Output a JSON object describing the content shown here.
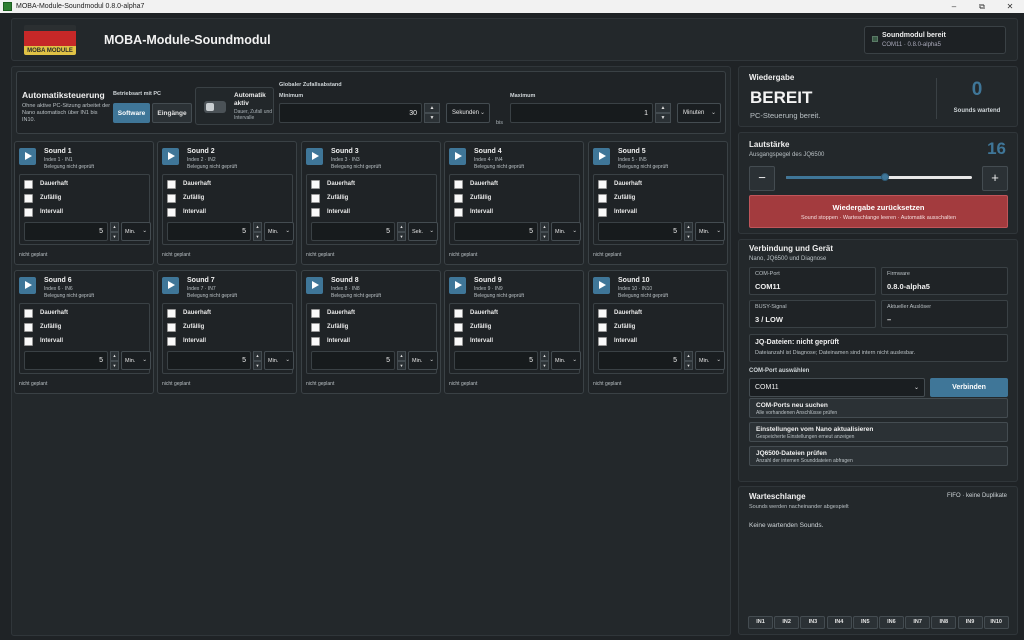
{
  "window": {
    "title": "MOBA-Module-Soundmodul 0.8.0-alpha7",
    "min": "–",
    "max": "⧉",
    "close": "✕"
  },
  "header": {
    "logo_text": "MOBA MODULE",
    "app_title": "MOBA-Module-Soundmodul",
    "status_title": "Soundmodul bereit",
    "status_sub": "COM11 · 0.8.0-alpha5"
  },
  "auto": {
    "title": "Automatiksteuerung",
    "desc": "Ohne aktive PC-Sitzung arbeitet der Nano automatisch über IN1 bis IN10.",
    "mode_label": "Betriebsart mit PC",
    "btn_software": "Software",
    "btn_eingaenge": "Eingänge",
    "automatik_title": "Automatik aktiv",
    "automatik_desc": "Dauer, Zufall und Intervalle",
    "global_title": "Globaler Zufallsabstand",
    "min_label": "Minimum",
    "min_value": "30",
    "min_unit": "Sekunden",
    "bis": "bis",
    "max_label": "Maximum",
    "max_value": "1",
    "max_unit": "Minuten"
  },
  "cards_common": {
    "belegung": "Belegung nicht geprüft",
    "opt_dauer": "Dauerhaft",
    "opt_zufall": "Zufällig",
    "opt_intervall": "Intervall",
    "plan": "nicht geplant",
    "spin_up": "▲",
    "spin_down": "▼"
  },
  "sounds": [
    {
      "title": "Sound 1",
      "index": "Index 1 · IN1",
      "value": "5",
      "unit": "Min."
    },
    {
      "title": "Sound 2",
      "index": "Index 2 · IN2",
      "value": "5",
      "unit": "Min."
    },
    {
      "title": "Sound 3",
      "index": "Index 3 · IN3",
      "value": "5",
      "unit": "Sek."
    },
    {
      "title": "Sound 4",
      "index": "Index 4 · IN4",
      "value": "5",
      "unit": "Min."
    },
    {
      "title": "Sound 5",
      "index": "Index 5 · IN5",
      "value": "5",
      "unit": "Min."
    },
    {
      "title": "Sound 6",
      "index": "Index 6 · IN6",
      "value": "5",
      "unit": "Min."
    },
    {
      "title": "Sound 7",
      "index": "Index 7 · IN7",
      "value": "5",
      "unit": "Min."
    },
    {
      "title": "Sound 8",
      "index": "Index 8 · IN8",
      "value": "5",
      "unit": "Min."
    },
    {
      "title": "Sound 9",
      "index": "Index 9 · IN9",
      "value": "5",
      "unit": "Min."
    },
    {
      "title": "Sound 10",
      "index": "Index 10 · IN10",
      "value": "5",
      "unit": "Min."
    }
  ],
  "wiedergabe": {
    "title": "Wiedergabe",
    "state": "BEREIT",
    "sub": "PC-Steuerung bereit.",
    "waiting_count": "0",
    "waiting_label": "Sounds wartend"
  },
  "lautstaerke": {
    "title": "Lautstärke",
    "sub": "Ausgangspegel des JQ6500",
    "value": "16",
    "level_fraction": 0.53,
    "minus": "−",
    "plus": "+",
    "reset_title": "Wiedergabe zurücksetzen",
    "reset_sub": "Sound stoppen · Warteschlange leeren · Automatik ausschalten"
  },
  "verbindung": {
    "title": "Verbindung und Gerät",
    "sub": "Nano, JQ6500 und Diagnose",
    "com_port_label": "COM-Port",
    "com_port_value": "COM11",
    "firmware_label": "Firmware",
    "firmware_value": "0.8.0-alpha5",
    "busy_label": "BUSY-Signal",
    "busy_value": "3 / LOW",
    "trigger_label": "Aktueller Auslöser",
    "trigger_value": "–",
    "jq_title": "JQ-Dateien: nicht geprüft",
    "jq_sub": "Dateianzahl ist Diagnose; Dateinamen sind intern nicht auslesbar.",
    "select_label": "COM-Port auswählen",
    "select_value": "COM11",
    "connect": "Verbinden",
    "actions": [
      {
        "title": "COM-Ports neu suchen",
        "sub": "Alle vorhandenen Anschlüsse prüfen"
      },
      {
        "title": "Einstellungen vom Nano aktualisieren",
        "sub": "Gespeicherte Einstellungen erneut anzeigen"
      },
      {
        "title": "JQ6500-Dateien prüfen",
        "sub": "Anzahl der internen Sounddateien abfragen"
      }
    ]
  },
  "warteschlange": {
    "title": "Warteschlange",
    "sub": "Sounds werden nacheinander abgespielt",
    "fifo": "FIFO · keine Duplikate",
    "empty": "Keine wartenden Sounds.",
    "inputs": [
      "IN1",
      "IN2",
      "IN3",
      "IN4",
      "IN5",
      "IN6",
      "IN7",
      "IN8",
      "IN9",
      "IN10"
    ]
  },
  "colors": {
    "accent": "#3f7698",
    "danger": "#a33b3e",
    "background": "#1f2326",
    "panel": "#23282b"
  }
}
